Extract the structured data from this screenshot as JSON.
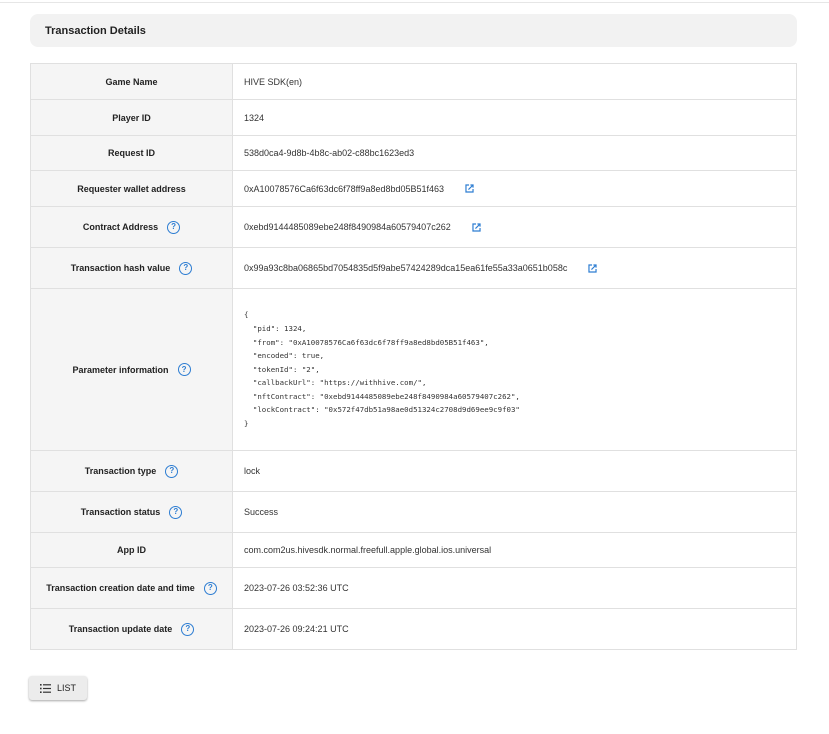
{
  "header": {
    "title": "Transaction Details"
  },
  "rows": [
    {
      "label": "Game Name",
      "value": "HIVE SDK(en)"
    },
    {
      "label": "Player ID",
      "value": "1324"
    },
    {
      "label": "Request ID",
      "value": "538d0ca4-9d8b-4b8c-ab02-c88bc1623ed3"
    },
    {
      "label": "Requester wallet address",
      "value": "0xA10078576Ca6f63dc6f78ff9a8ed8bd05B51f463"
    },
    {
      "label": "Contract Address",
      "value": "0xebd9144485089ebe248f8490984a60579407c262"
    },
    {
      "label": "Transaction hash value",
      "value": "0x99a93c8ba06865bd7054835d5f9abe57424289dca15ea61fe55a33a0651b058c"
    },
    {
      "label": "Parameter information",
      "value": "{\n  \"pid\": 1324,\n  \"from\": \"0xA10078576Ca6f63dc6f78ff9a8ed8bd05B51f463\",\n  \"encoded\": true,\n  \"tokenId\": \"2\",\n  \"callbackUrl\": \"https://withhive.com/\",\n  \"nftContract\": \"0xebd9144485089ebe248f8490984a60579407c262\",\n  \"lockContract\": \"0x572f47db51a98ae0d51324c2708d9d69ee9c9f03\"\n}"
    },
    {
      "label": "Transaction type",
      "value": "lock"
    },
    {
      "label": "Transaction status",
      "value": "Success"
    },
    {
      "label": "App ID",
      "value": "com.com2us.hivesdk.normal.freefull.apple.global.ios.universal"
    },
    {
      "label": "Transaction creation date and time",
      "value": "2023-07-26 03:52:36 UTC"
    },
    {
      "label": "Transaction update date",
      "value": "2023-07-26 09:24:21 UTC"
    }
  ],
  "help_icon_glyph": "?",
  "list_button": {
    "label": "LIST",
    "icon": "list-icon"
  },
  "colors": {
    "accent": "#2d7dd2",
    "label_bg": "#f5f5f5",
    "header_bg": "#f2f2f2",
    "border": "#e0e0e0"
  }
}
